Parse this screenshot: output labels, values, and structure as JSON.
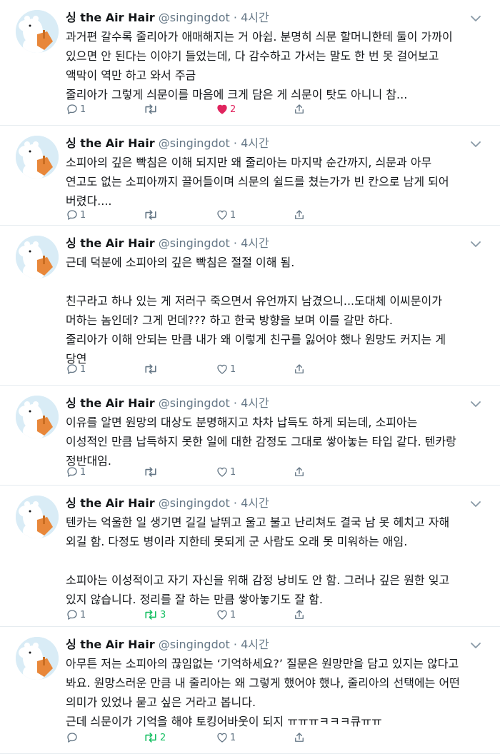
{
  "colors": {
    "retweet_active": "#17bf63",
    "like_active": "#e0245e",
    "muted": "#657786",
    "avatar_bg": "#d9ecf6"
  },
  "tweets": [
    {
      "name": "싱 the Air Hair",
      "handle": "@singingdot",
      "dot": "·",
      "time": "4시간",
      "text": "과거편 갈수록 줄리아가 애매해지는 거 아쉽. 분명히 싀문 할머니한테 둘이 가까이\n있으면 안 된다는 이야기 들었는데, 다 감수하고 가서는 말도 한 번 못 걸어보고\n액막이 역만 하고 와서 주금\n줄리아가 그렇게 싀문이를 마음에 크게 담은 게 싀문이 탓도 아니니 참...",
      "replies": "1",
      "retweets": "",
      "likes": "2",
      "retweeted": false,
      "liked": true
    },
    {
      "name": "싱 the Air Hair",
      "handle": "@singingdot",
      "dot": "·",
      "time": "4시간",
      "text": "소피아의 깊은 빡침은 이해 되지만 왜 줄리아는 마지막 순간까지, 싀문과 아무\n연고도 없는 소피아까지 끌어들이며 싀문의 쉴드를 쳤는가가 빈 칸으로 남게 되어\n버렸다....",
      "replies": "1",
      "retweets": "",
      "likes": "1",
      "retweeted": false,
      "liked": false
    },
    {
      "name": "싱 the Air Hair",
      "handle": "@singingdot",
      "dot": "·",
      "time": "4시간",
      "text": "근데 덕분에 소피아의 깊은 빡침은 절절 이해 됨.\n\n친구라고 하나 있는 게 저러구 죽으면서 유언까지 남겼으니...도대체 이씨문이가\n머하는 놈인데? 그게 먼데??? 하고 한국 방향을 보며 이를 갈만 하다.\n줄리아가 이해 안되는 만큼 내가 왜 이렇게 친구를 잃어야 했나 원망도 커지는 게\n당연",
      "replies": "1",
      "retweets": "",
      "likes": "1",
      "retweeted": false,
      "liked": false
    },
    {
      "name": "싱 the Air Hair",
      "handle": "@singingdot",
      "dot": "·",
      "time": "4시간",
      "text": "이유를 알면 원망의 대상도 분명해지고 차차 납득도 하게 되는데, 소피아는\n이성적인 만큼 납득하지 못한 일에 대한 감정도 그대로 쌓아놓는 타입 같다. 텐카랑\n정반대임.",
      "replies": "1",
      "retweets": "",
      "likes": "1",
      "retweeted": false,
      "liked": false
    },
    {
      "name": "싱 the Air Hair",
      "handle": "@singingdot",
      "dot": "·",
      "time": "4시간",
      "text": "텐카는 억울한 일 생기면 길길 날뛰고 울고 불고 난리쳐도 결국 남 못 헤치고 자해\n외길 함. 다정도 병이라 지한테 못되게 군 사람도 오래 못 미워하는 애임.\n\n소피아는 이성적이고 자기 자신을 위해 감정 낭비도 안 함. 그러나 깊은 원한 잊고\n있지 않습니다. 정리를 잘 하는 만큼 쌓아놓기도 잘 함.",
      "replies": "1",
      "retweets": "3",
      "likes": "1",
      "retweeted": true,
      "liked": false
    },
    {
      "name": "싱 the Air Hair",
      "handle": "@singingdot",
      "dot": "·",
      "time": "4시간",
      "text": "아무튼 저는 소피아의 끊임없는 ‘기억하세요?’ 질문은 원망만을 담고 있지는 않다고\n봐요. 원망스러운 만큼 내 줄리아는 왜 그렇게 했어야 했나, 줄리아의 선택에는 어떤\n의미가 있었나 묻고 싶은 거라고 봅니다.\n근데 싀문이가 기억을 해야 토킹어바웃이 되지 ㅠㅠㅠㅋㅋㅋ큐ㅠㅠ",
      "replies": "",
      "retweets": "2",
      "likes": "1",
      "retweeted": true,
      "liked": false
    }
  ]
}
